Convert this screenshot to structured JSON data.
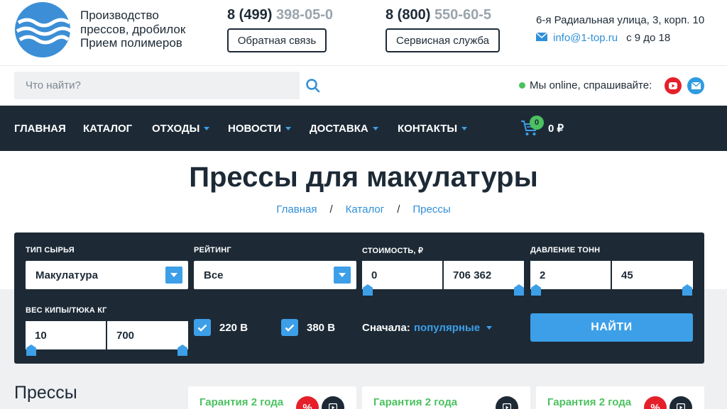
{
  "header": {
    "tagline": [
      "Производство",
      "прессов, дробилок",
      "Прием полимеров"
    ],
    "phone1": {
      "main": "8 (499)",
      "rest": "398-05-0"
    },
    "phone2": {
      "main": "8 (800)",
      "rest": "550-60-5"
    },
    "feedback_label": "Обратная связь",
    "service_label": "Сервисная служба",
    "address": "6-я Радиальная улица, 3, корп. 10",
    "email": "info@1-top.ru",
    "hours": "с 9 до 18"
  },
  "search": {
    "placeholder": "Что найти?"
  },
  "online": {
    "text": "Мы online, спрашивайте:"
  },
  "nav": {
    "items": [
      {
        "label": "ГЛАВНАЯ"
      },
      {
        "label": "КАТАЛОГ"
      },
      {
        "label": "ОТХОДЫ"
      },
      {
        "label": "НОВОСТИ"
      },
      {
        "label": "ДОСТАВКА"
      },
      {
        "label": "КОНТАКТЫ"
      }
    ],
    "cart_count": "0",
    "cart_sum": "0 ₽"
  },
  "page": {
    "title": "Прессы для макулатуры",
    "breadcrumbs": [
      "Главная",
      "Каталог",
      "Прессы"
    ],
    "breadcrumb_sep": "/"
  },
  "filter": {
    "raw_type": {
      "label": "ТИП СЫРЬЯ",
      "value": "Макулатура"
    },
    "rating": {
      "label": "РЕЙТИНГ",
      "value": "Все"
    },
    "price": {
      "label": "СТОИМОСТЬ, ₽",
      "min": "0",
      "max": "706 362"
    },
    "pressure": {
      "label": "ДАВЛЕНИЕ ТОНН",
      "min": "2",
      "max": "45"
    },
    "bale_weight": {
      "label": "ВЕС КИПЫ/ТЮКА КГ",
      "min": "10",
      "max": "700"
    },
    "voltage": [
      {
        "label": "220 В",
        "checked": true
      },
      {
        "label": "380 В",
        "checked": true
      }
    ],
    "sort": {
      "label": "Сначала:",
      "value": "популярные"
    },
    "submit_label": "НАЙТИ"
  },
  "content": {
    "section_title": "Прессы",
    "cards": [
      {
        "badge": "Гарантия 2 года",
        "discount": "%"
      },
      {
        "badge": "Гарантия 2 года",
        "discount": ""
      },
      {
        "badge": "Гарантия 2 года",
        "discount": "%"
      }
    ]
  },
  "colors": {
    "dark": "#1d2a36",
    "accent": "#3c9fe8",
    "green": "#4cc160",
    "red": "#e5202a"
  }
}
